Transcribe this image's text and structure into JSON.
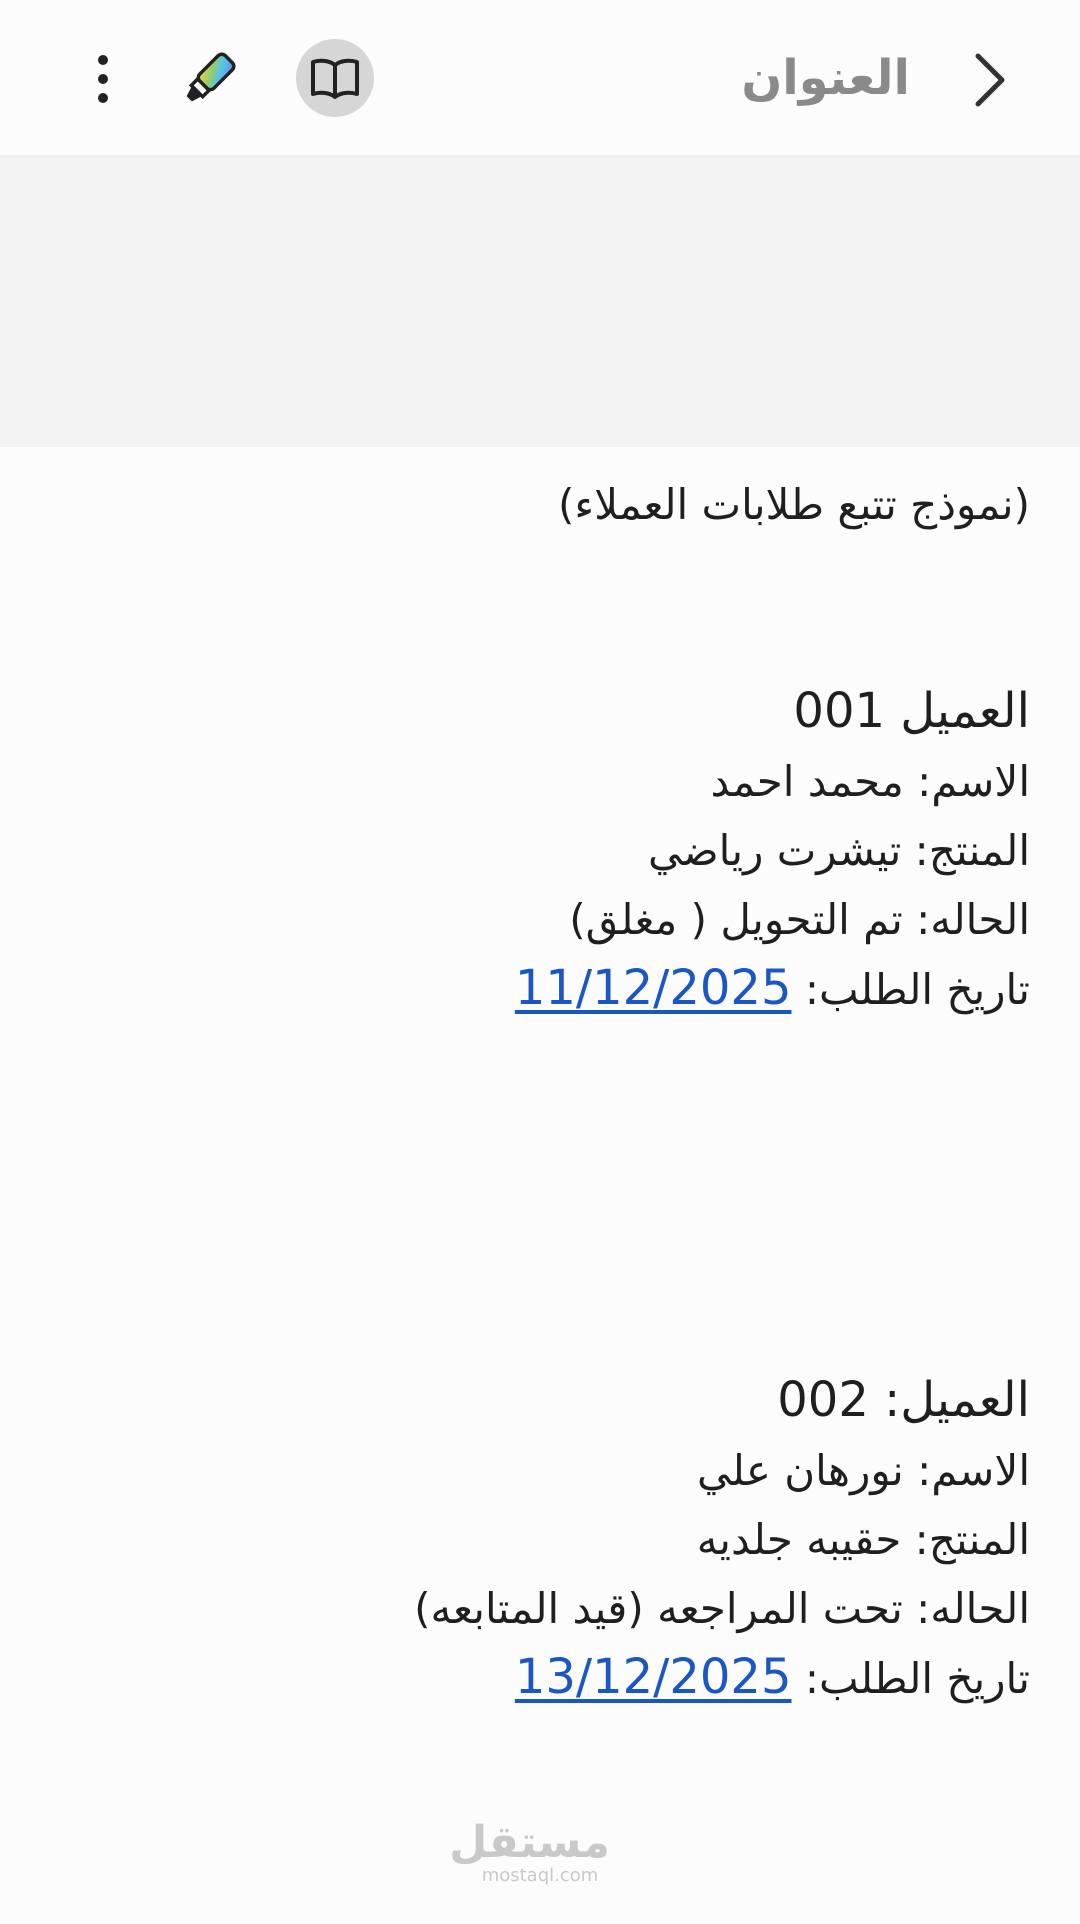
{
  "header": {
    "title": "العنوان",
    "back_icon": "chevron-right-icon",
    "reader_icon": "open-book-icon",
    "highlighter_icon": "highlighter-icon",
    "more_icon": "more-vertical-icon"
  },
  "doc": {
    "heading": "(نموذج تتبع طلابات العملاء)",
    "customers": [
      {
        "id_line": "العميل 001",
        "name_line": "الاسم: محمد احمد",
        "product_line": "المنتج: تيشرت رياضي",
        "status_line": "الحاله: تم التحويل ( مغلق)",
        "date_label": "تاريخ الطلب: ",
        "date_value": "11/12/2025"
      },
      {
        "id_line": "العميل: 002",
        "name_line": "الاسم: نورهان علي",
        "product_line": "المنتج: حقيبه جلديه",
        "status_line": "الحاله: تحت المراجعه (قيد المتابعه)",
        "date_label": "تاريخ الطلب: ",
        "date_value": "13/12/2025"
      }
    ]
  },
  "watermark": {
    "arabic": "مستقل",
    "latin": "mostaql.com"
  },
  "colors": {
    "link": "#1a56c4",
    "title": "#8a8a8a",
    "reader_bg": "#d6d6d6",
    "banner_bg": "#f3f3f3"
  }
}
